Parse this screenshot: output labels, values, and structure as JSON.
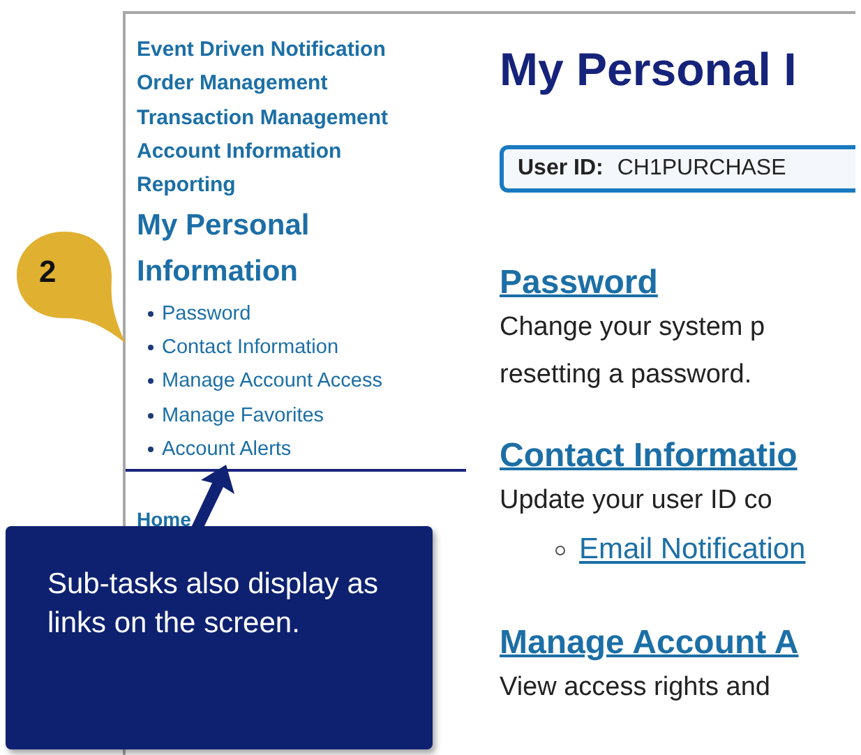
{
  "sidebar": {
    "items": [
      {
        "label": "Event Driven Notification"
      },
      {
        "label": "Order Management"
      },
      {
        "label": "Transaction Management"
      },
      {
        "label": "Account Information"
      },
      {
        "label": "Reporting"
      }
    ],
    "current_section": "My Personal Information",
    "sub_items": [
      {
        "label": "Password"
      },
      {
        "label": "Contact Information"
      },
      {
        "label": "Manage Account Access"
      },
      {
        "label": "Manage Favorites"
      },
      {
        "label": "Account Alerts"
      }
    ],
    "footer_link": "Home"
  },
  "main": {
    "title": "My Personal I",
    "user_id": {
      "label": "User ID:",
      "value": "CH1PURCHASE"
    },
    "sections": [
      {
        "heading": "Password",
        "lines": [
          "Change your system p",
          "resetting a password."
        ]
      },
      {
        "heading": "Contact Informatio",
        "lines": [
          "Update your user ID co"
        ],
        "links": [
          "Email Notification"
        ]
      },
      {
        "heading": "Manage Account A",
        "lines": [
          "View access rights and"
        ]
      }
    ]
  },
  "callouts": [
    {
      "kind": "badge",
      "text": "2"
    },
    {
      "kind": "note",
      "text": "Sub-tasks also display as links on the screen."
    }
  ]
}
